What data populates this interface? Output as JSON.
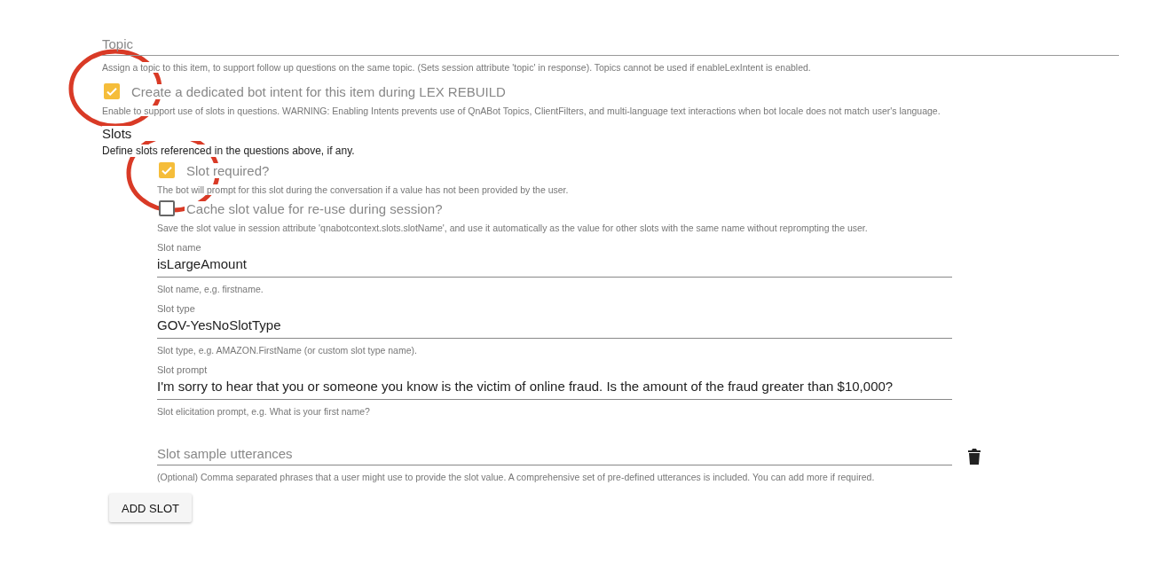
{
  "topic": {
    "placeholder": "Topic",
    "hint": "Assign a topic to this item, to support follow up questions on the same topic. (Sets session attribute 'topic' in response). Topics cannot be used if enableLexIntent is enabled."
  },
  "intent": {
    "label": "Create a dedicated bot intent for this item during LEX REBUILD",
    "checked": true,
    "hint": "Enable to support use of slots in questions. WARNING: Enabling Intents prevents use of QnABot Topics, ClientFilters, and multi-language text interactions when bot locale does not match user's language."
  },
  "slots": {
    "title": "Slots",
    "description": "Define slots referenced in the questions above, if any.",
    "options": [
      {
        "label": "Slot required?",
        "checked": true,
        "hint": "The bot will prompt for this slot during the conversation if a value has not been provided by the user."
      },
      {
        "label": "Cache slot value for re-use during session?",
        "checked": false,
        "hint": "Save the slot value in session attribute 'qnabotcontext.slots.slotName', and use it automatically as the value for other slots with the same name without reprompting the user."
      }
    ],
    "fields": [
      {
        "label": "Slot name",
        "value": "isLargeAmount",
        "hint": "Slot name, e.g. firstname."
      },
      {
        "label": "Slot type",
        "value": "GOV-YesNoSlotType",
        "hint": "Slot type, e.g. AMAZON.FirstName (or custom slot type name)."
      },
      {
        "label": "Slot prompt",
        "value": "I'm sorry to hear that you or someone you know is the victim of online fraud. Is the amount of the fraud greater than $10,000?",
        "hint": "Slot elicitation prompt, e.g. What is your first name?"
      },
      {
        "placeholder": "Slot sample utterances",
        "hint": "(Optional) Comma separated phrases that a user might use to provide the slot value. A comprehensive set of pre-defined utterances is included. You can add more if required.",
        "deletable": true
      }
    ],
    "add_button": "ADD SLOT"
  }
}
